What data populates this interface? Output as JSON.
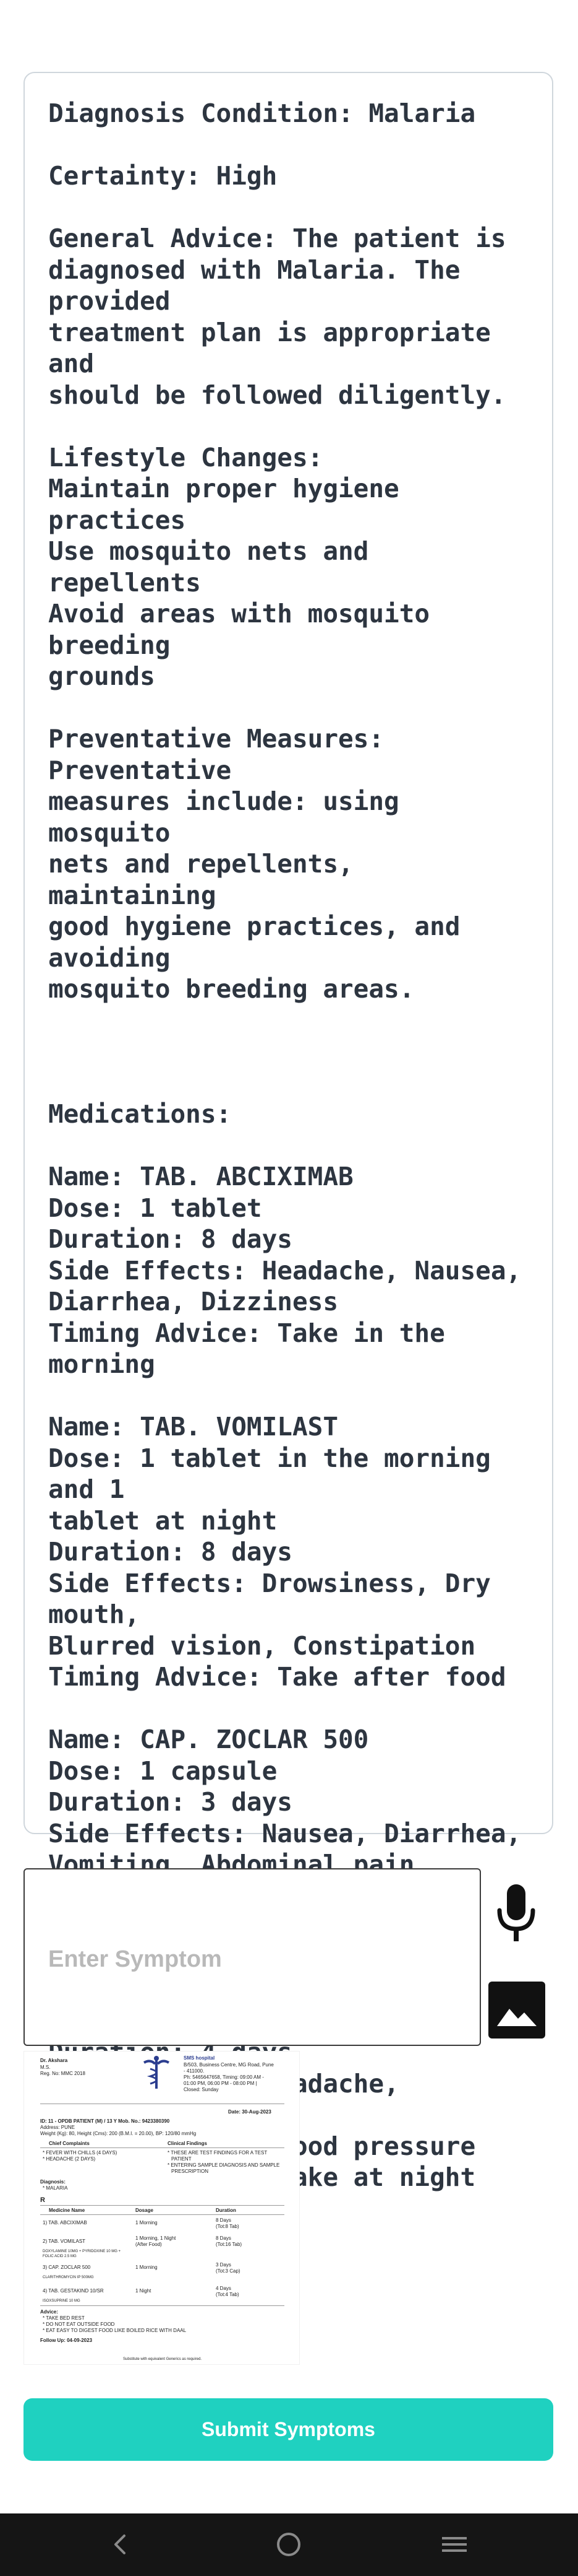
{
  "diagnosis": {
    "text": "Diagnosis Condition: Malaria\n\nCertainty: High\n\nGeneral Advice: The patient is\ndiagnosed with Malaria. The provided\ntreatment plan is appropriate and\nshould be followed diligently.\n\nLifestyle Changes:\nMaintain proper hygiene practices\nUse mosquito nets and repellents\nAvoid areas with mosquito breeding\ngrounds\n\nPreventative Measures: Preventative\nmeasures include: using mosquito\nnets and repellents, maintaining\ngood hygiene practices, and avoiding\nmosquito breeding areas.\n\n\n\nMedications:\n\nName: TAB. ABCIXIMAB\nDose: 1 tablet\nDuration: 8 days\nSide Effects: Headache, Nausea,\nDiarrhea, Dizziness\nTiming Advice: Take in the morning\n\nName: TAB. VOMILAST\nDose: 1 tablet in the morning and 1\ntablet at night\nDuration: 8 days\nSide Effects: Drowsiness, Dry mouth,\nBlurred vision, Constipation\nTiming Advice: Take after food\n\nName: CAP. ZOCLAR 500\nDose: 1 capsule\nDuration: 3 days\nSide Effects: Nausea, Diarrhea,\nVomiting, Abdominal pain\nTiming Advice: Take in the morning\n\nName: TAB. GESTAKIND 10/SR\nDose: 1 tablet\nDuration: 4 days\nSide Effects: Headache, Dizziness,\nFlushing, Low blood pressure\nTiming Advice: Take at night"
  },
  "symptom_input": {
    "placeholder": "Enter Symptom",
    "value": ""
  },
  "icons": {
    "mic": "microphone-icon",
    "image": "image-icon",
    "back": "back-icon",
    "home": "home-icon",
    "menu": "menu-icon"
  },
  "prescription": {
    "doctor": "Dr. Akshara",
    "qualification": "M.S.",
    "reg": "Reg. No: MMC 2018",
    "hospital": "SMS hospital",
    "addr1": "B/503, Business Centre, MG Road, Pune",
    "addr2": "- 411000.",
    "phone": "Ph: 5465647658, Timing: 09:00 AM -",
    "timing": "01:00 PM, 06:00 PM - 08:00 PM |",
    "closed": "Closed: Sunday",
    "date": "Date: 30-Aug-2023",
    "patient": "ID: 11 - OPDB PATIENT (M) / 13 Y   Mob. No.: 9423380390",
    "address": "Address: PUNE",
    "vitals": "Weight (Kg): 80, Height (Cms): 200 (B.M.I. = 20.00), BP: 120/80 mmHg",
    "chief_hdr": "Chief Complaints",
    "clinical_hdr": "Clinical Findings",
    "c1": "* FEVER WITH CHILLS (4 DAYS)",
    "c2": "* HEADACHE (2 DAYS)",
    "f1": "* THESE ARE TEST FINDINGS FOR A TEST",
    "f2": "PATIENT",
    "f3": "* ENTERING SAMPLE DIAGNOSIS AND SAMPLE",
    "f4": "PRESCRIPTION",
    "dx_hdr": "Diagnosis:",
    "dx": "* MALARIA",
    "rx": "R",
    "col_med": "Medicine Name",
    "col_dose": "Dosage",
    "col_dur": "Duration",
    "m1": "1) TAB. ABCIXIMAB",
    "m1d": "1 Morning",
    "m1t": "8 Days",
    "m1t2": "(Tot:8 Tab)",
    "m2": "2) TAB. VOMILAST",
    "m2d": "1 Morning, 1 Night",
    "m2d2": "(After Food)",
    "m2t": "8 Days",
    "m2t2": "(Tot:16 Tab)",
    "m2g": "DOXYLAMINE 10MG + PYRIDOXINE 10 MG +",
    "m2g2": "FOLIC ACID 2.5 MG",
    "m3": "3) CAP. ZOCLAR 500",
    "m3d": "1 Morning",
    "m3t": "3 Days",
    "m3t2": "(Tot:3 Cap)",
    "m3g": "CLARITHROMYCIN IP 500MG",
    "m4": "4) TAB. GESTAKIND 10/SR",
    "m4d": "1 Night",
    "m4t": "4 Days",
    "m4t2": "(Tot:4 Tab)",
    "m4g": "ISOXSUPRINE 10 MG",
    "advice_hdr": "Advice:",
    "a1": "* TAKE BED REST",
    "a2": "* DO NOT EAT OUTSIDE FOOD",
    "a3": "* EAT EASY TO DIGEST FOOD LIKE BOILED RICE WITH DAAL",
    "followup": "Follow Up: 04-09-2023",
    "footer": "Substitute with equivalent Generics as required."
  },
  "submit": {
    "label": "Submit Symptoms"
  },
  "colors": {
    "accent": "#1fd1c0",
    "text": "#2d3540",
    "navbar": "#151515"
  }
}
